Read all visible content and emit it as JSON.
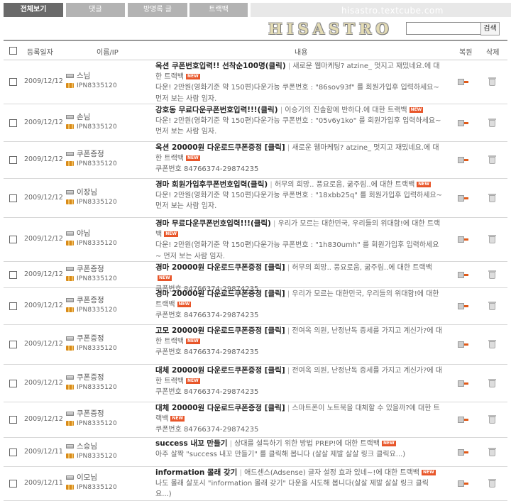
{
  "tabs": [
    {
      "label": "전체보기",
      "active": true
    },
    {
      "label": "댓글",
      "active": false
    },
    {
      "label": "방명록 글",
      "active": false
    },
    {
      "label": "트랙백",
      "active": false
    }
  ],
  "site": {
    "url": "hisastro.textcube.com",
    "logo": "HISASTRO"
  },
  "search": {
    "value": "",
    "button_label": "검색"
  },
  "headers": {
    "date": "등록일자",
    "name": "이름/IP",
    "content": "내용",
    "restore": "복원",
    "delete": "삭제"
  },
  "new_badge": "NEW",
  "rows": [
    {
      "date": "2009/12/12",
      "name": "스님",
      "ip": "IPN8335120",
      "title": "옥션 쿠폰번호입력!! 선착순100명(클릭)",
      "source": "새로운 웹마케팅? atzine_ 멋지고 재밌네요.에 대한 트랙백",
      "body": "다운! 2만원(영화기준 약 150편)다운가능 쿠폰번호 : \"86sov93f\" 를 회원가입후 입력하세요~ 먼저 보는 사람 임자."
    },
    {
      "date": "2009/12/12",
      "name": "손님",
      "ip": "IPN8335120",
      "title": "강호동 무료다운쿠폰번호입력!!!(클릭)",
      "source": "이승기의 진솔함에 반하다.에 대한 트랙백",
      "body": "다운! 2만원(영화기준 약 150편)다운가능 쿠폰번호 : \"05v6y1ko\" 를 회원가입후 입력하세요~ 먼저 보는 사람 임자."
    },
    {
      "date": "2009/12/12",
      "name": "쿠폰증정",
      "ip": "IPN8335120",
      "title": "옥션 20000원 다운로드쿠폰증정 [클릭]",
      "source": "새로운 웹마케팅? atzine_ 멋지고 재밌네요.에 대한 트랙백",
      "body": "쿠폰번호 84766374-29874235"
    },
    {
      "date": "2009/12/12",
      "name": "이장님",
      "ip": "IPN8335120",
      "title": "경마 회원가입후쿠폰번호입력(클릭)",
      "source": "허무의 희망.. 풍요로움, 굶주림..에 대한 트랙백",
      "body": "다운! 2만원(영화기준 약 150편)다운가능 쿠폰번호 : \"18xbb25q\" 를 회원가입후 입력하세요~ 먼저 보는 사람 임자."
    },
    {
      "date": "2009/12/12",
      "name": "야님",
      "ip": "IPN8335120",
      "title": "경마 무료다운쿠폰번호입력!!!(클릭)",
      "source": "우리가 모르는 대한민국, 우리들의 위대함!에 대한 트랙백",
      "body": "다운! 2만원(영화기준 약 150편)다운가능 쿠폰번호 : \"1h830umh\" 를 회원가입후 입력하세요~ 먼저 보는 사람 임자."
    },
    {
      "date": "2009/12/12",
      "name": "쿠폰증정",
      "ip": "IPN8335120",
      "title": "경마 20000원 다운로드쿠폰증정 [클릭]",
      "source": "허무의 희망.. 풍요로움, 굶주림..에 대한 트랙백",
      "body": "쿠폰번호 84766374-29874235"
    },
    {
      "date": "2009/12/12",
      "name": "쿠폰증정",
      "ip": "IPN8335120",
      "title": "경마 20000원 다운로드쿠폰증정 [클릭]",
      "source": "우리가 모르는 대한민국, 우리들의 위대함!에 대한 트랙백",
      "body": "쿠폰번호 84766374-29874235"
    },
    {
      "date": "2009/12/12",
      "name": "쿠폰증정",
      "ip": "IPN8335120",
      "title": "고모 20000원 다운로드쿠폰증정 [클릭]",
      "source": "전여옥 의원, 난정난독 증세를 가지고 계신가?에 대한 트랙백",
      "body": "쿠폰번호 84766374-29874235"
    },
    {
      "date": "2009/12/12",
      "name": "쿠폰증정",
      "ip": "IPN8335120",
      "title": "대체 20000원 다운로드쿠폰증정 [클릭]",
      "source": "전여옥 의원, 난정난독 증세를 가지고 계신가?에 대한 트랙백",
      "body": "쿠폰번호 84766374-29874235"
    },
    {
      "date": "2009/12/12",
      "name": "쿠폰증정",
      "ip": "IPN8335120",
      "title": "대체 20000원 다운로드쿠폰증정 [클릭]",
      "source": "스마트폰이 노트북을 대체할 수 있을까?에 대한 트랙백",
      "body": "쿠폰번호 84766374-29874235"
    },
    {
      "date": "2009/12/11",
      "name": "스승님",
      "ip": "IPN8335120",
      "title": "success 내꼬 만들기",
      "source": "상대를 설득하기 위한 방법 PREP!에 대한 트랙백",
      "body": "아주 살짝 \"success 내꼬 만들기\" 를 클릭해 봅니다 (살살 제발 살살 링크 클릭요...)"
    },
    {
      "date": "2009/12/11",
      "name": "이모님",
      "ip": "IPN8335120",
      "title": "information 몰래 갖기",
      "source": "애드센스(Adsense) 글자 설정 효과 있네~!에 대한 트랙백",
      "body": "나도 몰래 살포시 \"information 몰래 갖기\" 다운을 시도해 봅니다(살살 제발 살살 링크 클릭요...)"
    }
  ]
}
